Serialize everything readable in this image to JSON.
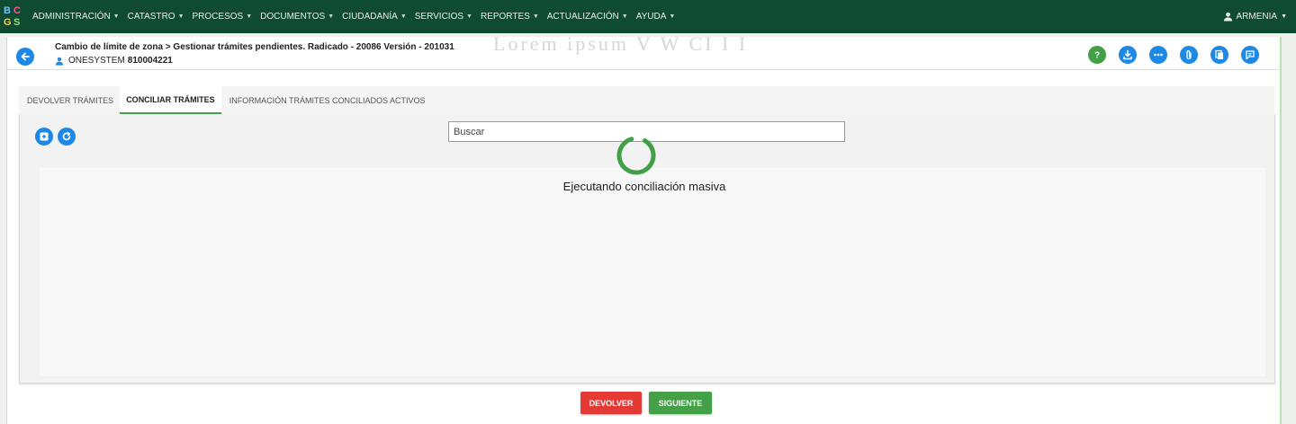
{
  "logo": {
    "letters": [
      "B",
      "C",
      "G",
      "S"
    ]
  },
  "nav": {
    "items": [
      {
        "label": "ADMINISTRACIÓN"
      },
      {
        "label": "CATASTRO"
      },
      {
        "label": "PROCESOS"
      },
      {
        "label": "DOCUMENTOS"
      },
      {
        "label": "CIUDADANÍA"
      },
      {
        "label": "SERVICIOS"
      },
      {
        "label": "REPORTES"
      },
      {
        "label": "ACTUALIZACIÓN"
      },
      {
        "label": "AYUDA"
      }
    ],
    "user": "ARMENIA"
  },
  "header": {
    "title": "Cambio de límite de zona > Gestionar trámites pendientes. Radicado - 20086 Versión - 201031",
    "user_name": "ONESYSTEM",
    "user_code": "810004221",
    "watermark": "Lorem ipsum   V W CI   I I"
  },
  "actions": [
    "help-icon",
    "download-icon",
    "more-icon",
    "attach-icon",
    "documents-icon",
    "comment-icon"
  ],
  "tabs": [
    {
      "label": "DEVOLVER TRÁMITES",
      "active": false
    },
    {
      "label": "CONCILIAR TRÁMITES",
      "active": true
    },
    {
      "label": "INFORMACIÓN TRÁMITES CONCILIADOS ACTIVOS",
      "active": false
    }
  ],
  "search": {
    "placeholder": "Buscar"
  },
  "loading": {
    "text": "Ejecutando conciliación masiva"
  },
  "buttons": {
    "return": "DEVOLVER",
    "next": "SIGUIENTE"
  },
  "colors": {
    "nav_bg": "#0f4a33",
    "primary": "#1e88e5",
    "success": "#43a047",
    "danger": "#e53935"
  }
}
